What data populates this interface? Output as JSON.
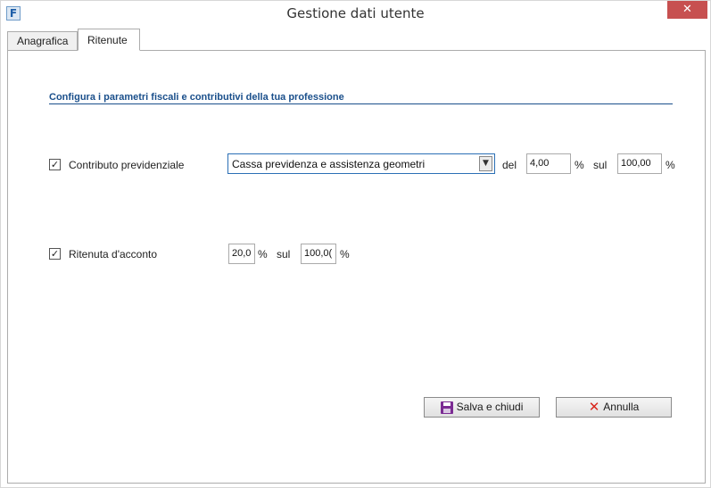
{
  "window": {
    "title": "Gestione dati utente",
    "app_icon_letter": "F",
    "close_glyph": "✕"
  },
  "tabs": [
    {
      "label": "Anagrafica",
      "active": false
    },
    {
      "label": "Ritenute",
      "active": true
    }
  ],
  "section": {
    "heading": "Configura i parametri fiscali e contributivi della tua professione"
  },
  "contributo": {
    "checked": true,
    "label": "Contributo previdenziale",
    "select_value": "Cassa previdenza e assistenza geometri",
    "del_label": "del",
    "rate_value": "4,00",
    "percent1": "%",
    "sul_label": "sul",
    "base_value": "100,00",
    "percent2": "%"
  },
  "ritenuta": {
    "checked": true,
    "label": "Ritenuta d'acconto",
    "rate_value": "20,0",
    "percent1": "%",
    "sul_label": "sul",
    "base_value": "100,0(",
    "percent2": "%"
  },
  "buttons": {
    "save_label": "Salva e chiudi",
    "save_icon": "floppy-disk-icon",
    "cancel_label": "Annulla",
    "cancel_icon": "x-icon"
  },
  "colors": {
    "accent": "#1a4f8b",
    "close": "#c75050",
    "save_icon": "#7b2b93",
    "cancel_icon": "#d9261c"
  }
}
